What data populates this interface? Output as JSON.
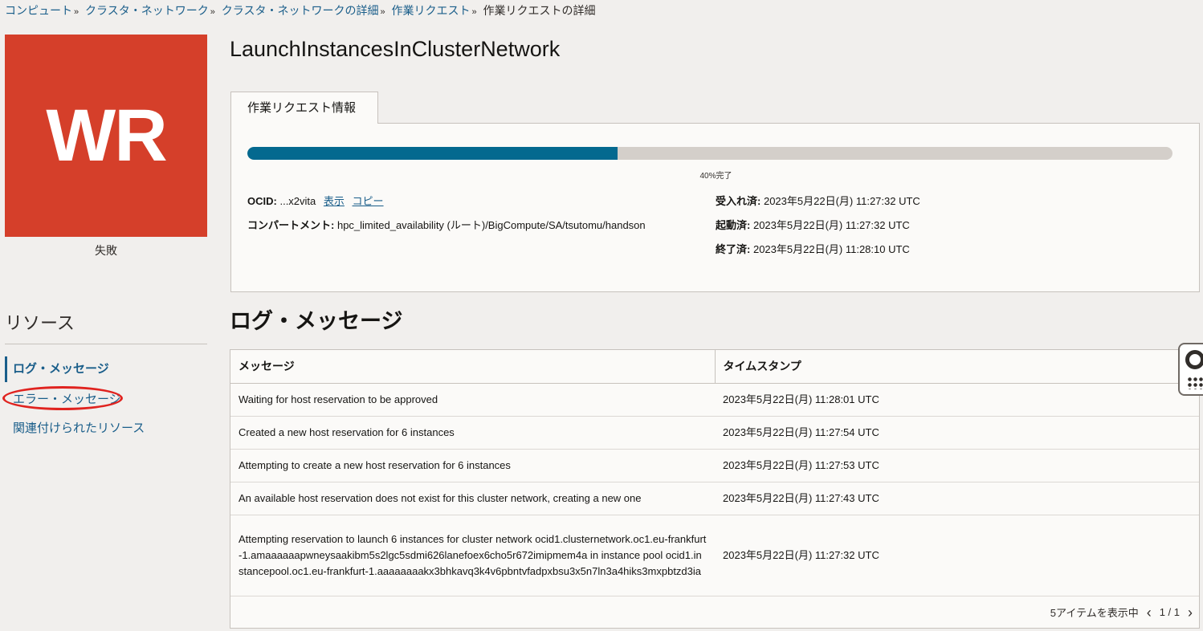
{
  "breadcrumb": {
    "items": [
      "コンピュート",
      "クラスタ・ネットワーク",
      "クラスタ・ネットワークの詳細",
      "作業リクエスト"
    ],
    "separator": "»",
    "current": "作業リクエストの詳細"
  },
  "status": {
    "initials": "WR",
    "label": "失敗",
    "color": "#d53f2a"
  },
  "title": "LaunchInstancesInClusterNetwork",
  "tab": {
    "label": "作業リクエスト情報"
  },
  "progress": {
    "percent": 40,
    "label": "40%完了",
    "color": "#04698f"
  },
  "info": {
    "ocid_key": "OCID:",
    "ocid_value": "...x2vita",
    "show_link": "表示",
    "copy_link": "コピー",
    "compartment_key": "コンパートメント:",
    "compartment_value": "hpc_limited_availability (ルート)/BigCompute/SA/tsutomu/handson",
    "accepted_key": "受入れ済:",
    "accepted_value": "2023年5月22日(月) 11:27:32 UTC",
    "started_key": "起動済:",
    "started_value": "2023年5月22日(月) 11:27:32 UTC",
    "finished_key": "終了済:",
    "finished_value": "2023年5月22日(月) 11:28:10 UTC"
  },
  "sidebar": {
    "heading": "リソース",
    "items": [
      {
        "label": "ログ・メッセージ",
        "active": true
      },
      {
        "label": "エラー・メッセージ",
        "active": false
      },
      {
        "label": "関連付けられたリソース",
        "active": false
      }
    ]
  },
  "log_section": {
    "heading": "ログ・メッセージ",
    "columns": [
      "メッセージ",
      "タイムスタンプ"
    ],
    "rows": [
      {
        "message": "Waiting for host reservation to be approved",
        "timestamp": "2023年5月22日(月) 11:28:01 UTC"
      },
      {
        "message": "Created a new host reservation for 6 instances",
        "timestamp": "2023年5月22日(月) 11:27:54 UTC"
      },
      {
        "message": "Attempting to create a new host reservation for 6 instances",
        "timestamp": "2023年5月22日(月) 11:27:53 UTC"
      },
      {
        "message": "An available host reservation does not exist for this cluster network, creating a new one",
        "timestamp": "2023年5月22日(月) 11:27:43 UTC"
      },
      {
        "message": "Attempting reservation to launch 6 instances for cluster network ocid1.clusternetwork.oc1.eu-frankfurt-1.amaaaaaapwneysaakibm5s2lgc5sdmi626lanefoex6cho5r672imipmem4a in instance pool ocid1.instancepool.oc1.eu-frankfurt-1.aaaaaaaakx3bhkavq3k4v6pbntvfadpxbsu3x5n7ln3a4hiks3mxpbtzd3ia",
        "timestamp": "2023年5月22日(月) 11:27:32 UTC"
      }
    ],
    "footer_count": "5アイテムを表示中",
    "page_indicator": "1 / 1"
  },
  "icons": {
    "prev_page": "chevron-left-icon",
    "next_page": "chevron-right-icon",
    "help": "lifebuoy-icon",
    "apps": "grid-dots-icon"
  }
}
